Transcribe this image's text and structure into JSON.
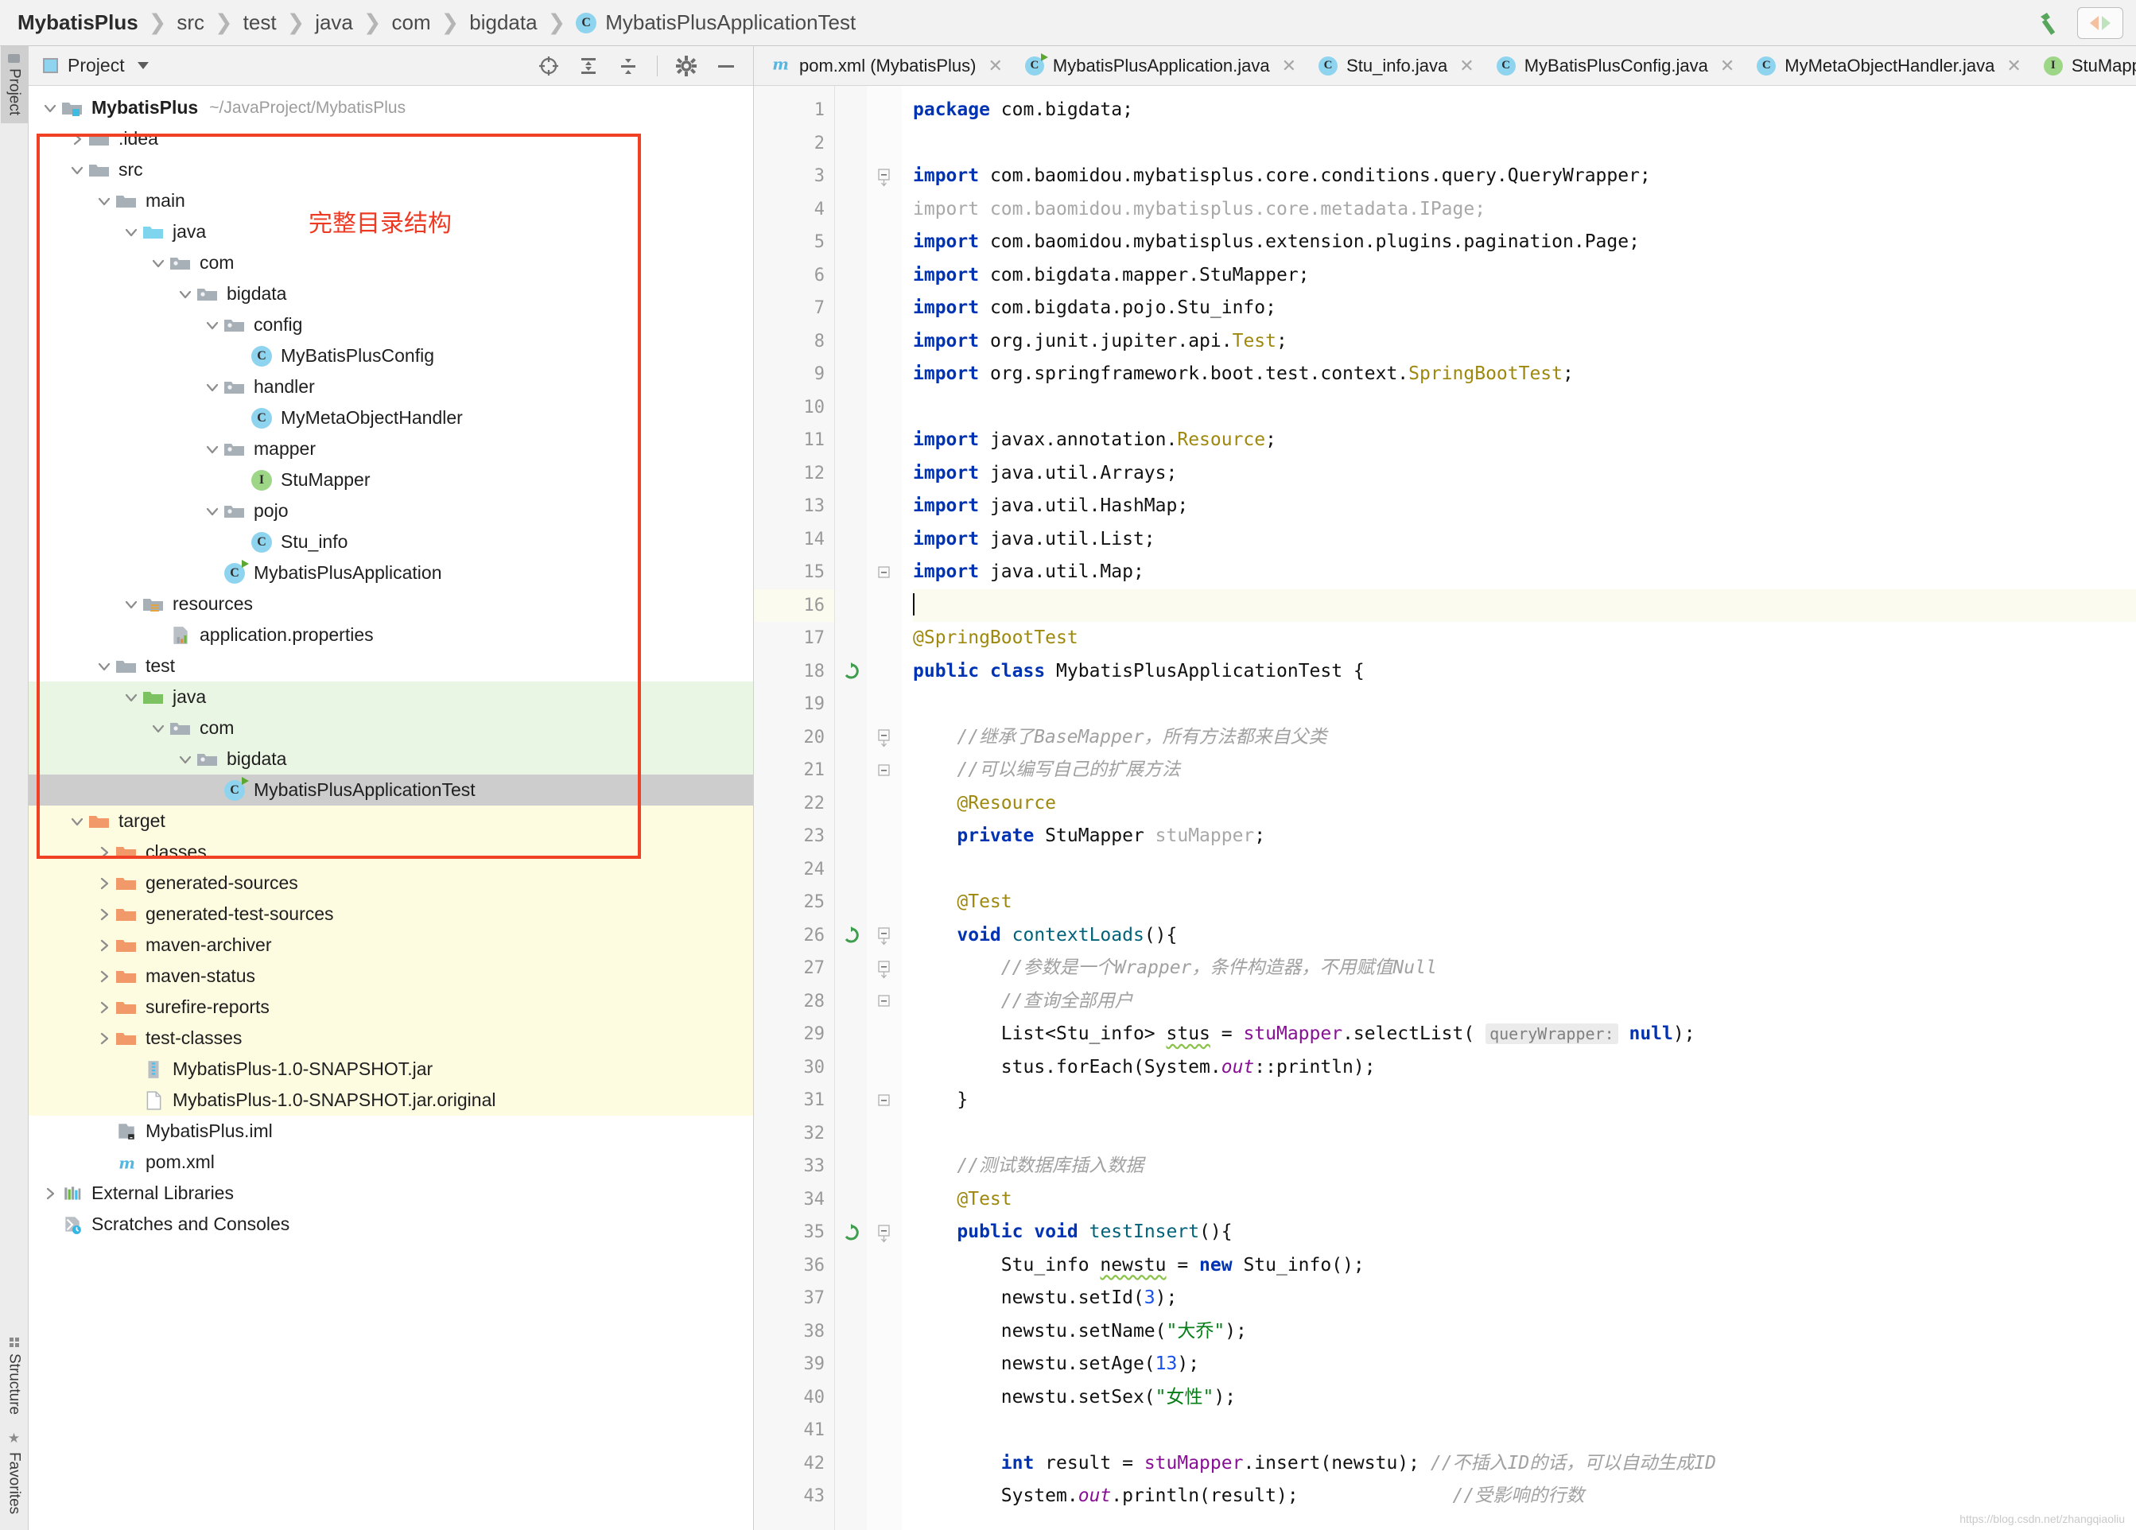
{
  "window": {
    "breadcrumb": [
      {
        "label": "MybatisPlus",
        "type": "root"
      },
      {
        "label": "src",
        "type": "folder"
      },
      {
        "label": "test",
        "type": "folder"
      },
      {
        "label": "java",
        "type": "folder"
      },
      {
        "label": "com",
        "type": "folder"
      },
      {
        "label": "bigdata",
        "type": "folder"
      },
      {
        "label": "MybatisPlusApplicationTest",
        "type": "class"
      }
    ],
    "build_icon": "hammer-icon",
    "layout_toggle_icon": "split-pane-icon"
  },
  "rail": {
    "top": [
      {
        "label": "Project",
        "icon": "project-folder-icon",
        "active": true
      }
    ],
    "bottom": [
      {
        "label": "Structure",
        "icon": "structure-icon",
        "active": false
      },
      {
        "label": "Favorites",
        "icon": "star-icon",
        "active": false
      }
    ]
  },
  "project_panel": {
    "title": "Project",
    "title_icon": "project-view-icon",
    "dropdown_icon": "chevron-down-icon",
    "tools": [
      {
        "name": "locate-in-tree-icon",
        "label": "Select Opened File"
      },
      {
        "name": "expand-all-icon",
        "label": "Expand All"
      },
      {
        "name": "collapse-all-icon",
        "label": "Collapse All"
      },
      {
        "name": "settings-gear-icon",
        "label": "Settings"
      },
      {
        "name": "minimize-icon",
        "label": "Hide"
      }
    ],
    "annotation": {
      "text": "完整目录结构",
      "color": "#ee3a23"
    }
  },
  "tree": [
    {
      "indent": 0,
      "arrow": "down",
      "icon": "module-folder",
      "label": "MybatisPlus",
      "bold": true,
      "path": "~/JavaProject/MybatisPlus",
      "bg": "none"
    },
    {
      "indent": 1,
      "arrow": "right",
      "icon": "folder-gray",
      "label": ".idea",
      "bg": "none"
    },
    {
      "indent": 1,
      "arrow": "down",
      "icon": "folder-gray",
      "label": "src",
      "bg": "none"
    },
    {
      "indent": 2,
      "arrow": "down",
      "icon": "folder-gray",
      "label": "main",
      "bg": "none"
    },
    {
      "indent": 3,
      "arrow": "down",
      "icon": "folder-source-blue",
      "label": "java",
      "bg": "none"
    },
    {
      "indent": 4,
      "arrow": "down",
      "icon": "folder-package",
      "label": "com",
      "bg": "none"
    },
    {
      "indent": 5,
      "arrow": "down",
      "icon": "folder-package",
      "label": "bigdata",
      "bg": "none"
    },
    {
      "indent": 6,
      "arrow": "down",
      "icon": "folder-package",
      "label": "config",
      "bg": "none"
    },
    {
      "indent": 7,
      "arrow": "none",
      "icon": "class-badge",
      "label": "MyBatisPlusConfig",
      "bg": "none"
    },
    {
      "indent": 6,
      "arrow": "down",
      "icon": "folder-package",
      "label": "handler",
      "bg": "none"
    },
    {
      "indent": 7,
      "arrow": "none",
      "icon": "class-badge",
      "label": "MyMetaObjectHandler",
      "bg": "none"
    },
    {
      "indent": 6,
      "arrow": "down",
      "icon": "folder-package",
      "label": "mapper",
      "bg": "none"
    },
    {
      "indent": 7,
      "arrow": "none",
      "icon": "interface-badge",
      "label": "StuMapper",
      "bg": "none"
    },
    {
      "indent": 6,
      "arrow": "down",
      "icon": "folder-package",
      "label": "pojo",
      "bg": "none"
    },
    {
      "indent": 7,
      "arrow": "none",
      "icon": "class-badge",
      "label": "Stu_info",
      "bg": "none"
    },
    {
      "indent": 6,
      "arrow": "none",
      "icon": "class-run-badge",
      "label": "MybatisPlusApplication",
      "bg": "none"
    },
    {
      "indent": 3,
      "arrow": "down",
      "icon": "folder-resources",
      "label": "resources",
      "bg": "none"
    },
    {
      "indent": 4,
      "arrow": "none",
      "icon": "properties-file",
      "label": "application.properties",
      "bg": "none"
    },
    {
      "indent": 2,
      "arrow": "down",
      "icon": "folder-gray",
      "label": "test",
      "bg": "none"
    },
    {
      "indent": 3,
      "arrow": "down",
      "icon": "folder-test-green",
      "label": "java",
      "bg": "testsrc"
    },
    {
      "indent": 4,
      "arrow": "down",
      "icon": "folder-package",
      "label": "com",
      "bg": "testsrc"
    },
    {
      "indent": 5,
      "arrow": "down",
      "icon": "folder-package",
      "label": "bigdata",
      "bg": "testsrc"
    },
    {
      "indent": 6,
      "arrow": "none",
      "icon": "class-run-badge",
      "label": "MybatisPlusApplicationTest",
      "bg": "selected"
    },
    {
      "indent": 1,
      "arrow": "down",
      "icon": "folder-orange",
      "label": "target",
      "bg": "excluded"
    },
    {
      "indent": 2,
      "arrow": "right",
      "icon": "folder-orange",
      "label": "classes",
      "bg": "excluded"
    },
    {
      "indent": 2,
      "arrow": "right",
      "icon": "folder-orange",
      "label": "generated-sources",
      "bg": "excluded"
    },
    {
      "indent": 2,
      "arrow": "right",
      "icon": "folder-orange",
      "label": "generated-test-sources",
      "bg": "excluded"
    },
    {
      "indent": 2,
      "arrow": "right",
      "icon": "folder-orange",
      "label": "maven-archiver",
      "bg": "excluded"
    },
    {
      "indent": 2,
      "arrow": "right",
      "icon": "folder-orange",
      "label": "maven-status",
      "bg": "excluded"
    },
    {
      "indent": 2,
      "arrow": "right",
      "icon": "folder-orange",
      "label": "surefire-reports",
      "bg": "excluded"
    },
    {
      "indent": 2,
      "arrow": "right",
      "icon": "folder-orange",
      "label": "test-classes",
      "bg": "excluded"
    },
    {
      "indent": 3,
      "arrow": "none",
      "icon": "jar-file",
      "label": "MybatisPlus-1.0-SNAPSHOT.jar",
      "bg": "excluded"
    },
    {
      "indent": 3,
      "arrow": "none",
      "icon": "generic-file",
      "label": "MybatisPlus-1.0-SNAPSHOT.jar.original",
      "bg": "excluded"
    },
    {
      "indent": 2,
      "arrow": "none",
      "icon": "iml-file",
      "label": "MybatisPlus.iml",
      "bg": "none"
    },
    {
      "indent": 2,
      "arrow": "none",
      "icon": "maven-file",
      "label": "pom.xml",
      "bg": "none"
    },
    {
      "indent": 0,
      "arrow": "right",
      "icon": "library-icon",
      "label": "External Libraries",
      "bg": "none"
    },
    {
      "indent": 0,
      "arrow": "none",
      "icon": "scratches-icon",
      "label": "Scratches and Consoles",
      "bg": "none"
    }
  ],
  "editor_tabs": [
    {
      "label": "pom.xml (MybatisPlus)",
      "icon": "maven-file",
      "active": false,
      "close_icon": "close-icon"
    },
    {
      "label": "MybatisPlusApplication.java",
      "icon": "class-run-badge",
      "active": false,
      "close_icon": "close-icon"
    },
    {
      "label": "Stu_info.java",
      "icon": "class-badge",
      "active": false,
      "close_icon": "close-icon"
    },
    {
      "label": "MyBatisPlusConfig.java",
      "icon": "class-badge",
      "active": false,
      "close_icon": "close-icon"
    },
    {
      "label": "MyMetaObjectHandler.java",
      "icon": "class-badge",
      "active": false,
      "close_icon": "close-icon"
    },
    {
      "label": "StuMapper.java",
      "icon": "interface-badge",
      "active": false,
      "close_icon": "close-icon"
    }
  ],
  "editor": {
    "caret_line": 16,
    "lines": [
      {
        "n": 1,
        "fold": "none",
        "run": false,
        "html": "<span class=\"kw\">package</span> com.bigdata;"
      },
      {
        "n": 2,
        "fold": "none",
        "run": false,
        "html": ""
      },
      {
        "n": 3,
        "fold": "open",
        "run": false,
        "html": "<span class=\"kw\">import</span> com.baomidou.mybatisplus.core.conditions.query.QueryWrapper;"
      },
      {
        "n": 4,
        "fold": "none",
        "run": false,
        "html": "<span class=\"dim\">import com.baomidou.mybatisplus.core.metadata.IPage;</span>"
      },
      {
        "n": 5,
        "fold": "none",
        "run": false,
        "html": "<span class=\"kw\">import</span> com.baomidou.mybatisplus.extension.plugins.pagination.Page;"
      },
      {
        "n": 6,
        "fold": "none",
        "run": false,
        "html": "<span class=\"kw\">import</span> com.bigdata.mapper.StuMapper;"
      },
      {
        "n": 7,
        "fold": "none",
        "run": false,
        "html": "<span class=\"kw\">import</span> com.bigdata.pojo.Stu_info;"
      },
      {
        "n": 8,
        "fold": "none",
        "run": false,
        "html": "<span class=\"kw\">import</span> org.junit.jupiter.api.<span class=\"ann\">Test</span>;"
      },
      {
        "n": 9,
        "fold": "none",
        "run": false,
        "html": "<span class=\"kw\">import</span> org.springframework.boot.test.context.<span class=\"ann\">SpringBootTest</span>;"
      },
      {
        "n": 10,
        "fold": "none",
        "run": false,
        "html": ""
      },
      {
        "n": 11,
        "fold": "none",
        "run": false,
        "html": "<span class=\"kw\">import</span> javax.annotation.<span class=\"ann\">Resource</span>;"
      },
      {
        "n": 12,
        "fold": "none",
        "run": false,
        "html": "<span class=\"kw\">import</span> java.util.Arrays;"
      },
      {
        "n": 13,
        "fold": "none",
        "run": false,
        "html": "<span class=\"kw\">import</span> java.util.HashMap;"
      },
      {
        "n": 14,
        "fold": "none",
        "run": false,
        "html": "<span class=\"kw\">import</span> java.util.List;"
      },
      {
        "n": 15,
        "fold": "close",
        "run": false,
        "html": "<span class=\"kw\">import</span> java.util.Map;"
      },
      {
        "n": 16,
        "fold": "none",
        "run": false,
        "hl": true,
        "html": "<span class=\"caret\"></span>"
      },
      {
        "n": 17,
        "fold": "none",
        "run": false,
        "html": "<span class=\"ann\">@SpringBootTest</span>"
      },
      {
        "n": 18,
        "fold": "none",
        "run": true,
        "html": "<span class=\"kw\">public</span> <span class=\"kw\">class</span> MybatisPlusApplicationTest {"
      },
      {
        "n": 19,
        "fold": "none",
        "run": false,
        "html": ""
      },
      {
        "n": 20,
        "fold": "open",
        "run": false,
        "html": "    <span class=\"cmt\">//继承了BaseMapper，所有方法都来自父类</span>"
      },
      {
        "n": 21,
        "fold": "close",
        "run": false,
        "html": "    <span class=\"cmt\">//可以编写自己的扩展方法</span>"
      },
      {
        "n": 22,
        "fold": "none",
        "run": false,
        "html": "    <span class=\"ann\">@Resource</span>"
      },
      {
        "n": 23,
        "fold": "none",
        "run": false,
        "html": "    <span class=\"kw\">private</span> StuMapper <span class=\"dim\">stuMapper</span>;"
      },
      {
        "n": 24,
        "fold": "none",
        "run": false,
        "html": ""
      },
      {
        "n": 25,
        "fold": "none",
        "run": false,
        "html": "    <span class=\"ann\">@Test</span>"
      },
      {
        "n": 26,
        "fold": "open",
        "run": true,
        "html": "    <span class=\"kw\">void</span> <span class=\"mth\">contextLoads</span>(){"
      },
      {
        "n": 27,
        "fold": "open",
        "run": false,
        "html": "        <span class=\"cmt\">//参数是一个Wrapper，条件构造器，不用赋值Null</span>"
      },
      {
        "n": 28,
        "fold": "close",
        "run": false,
        "html": "        <span class=\"cmt\">//查询全部用户</span>"
      },
      {
        "n": 29,
        "fold": "none",
        "run": false,
        "html": "        List&lt;Stu_info&gt; <span class=\"wavy\">stus</span> = <span class=\"fld\">stuMapper</span>.selectList( <span class=\"hint\">queryWrapper:</span> <span class=\"kw\">null</span>);"
      },
      {
        "n": 30,
        "fold": "none",
        "run": false,
        "html": "        stus.forEach(System.<span class=\"fldi\">out</span>::println);"
      },
      {
        "n": 31,
        "fold": "close",
        "run": false,
        "html": "    }"
      },
      {
        "n": 32,
        "fold": "none",
        "run": false,
        "html": ""
      },
      {
        "n": 33,
        "fold": "none",
        "run": false,
        "html": "    <span class=\"cmt\">//测试数据库插入数据</span>"
      },
      {
        "n": 34,
        "fold": "none",
        "run": false,
        "html": "    <span class=\"ann\">@Test</span>"
      },
      {
        "n": 35,
        "fold": "open",
        "run": true,
        "html": "    <span class=\"kw\">public</span> <span class=\"kw\">void</span> <span class=\"mth\">testInsert</span>(){"
      },
      {
        "n": 36,
        "fold": "none",
        "run": false,
        "html": "        Stu_info <span class=\"wavy\">newstu</span> = <span class=\"kw\">new</span> Stu_info();"
      },
      {
        "n": 37,
        "fold": "none",
        "run": false,
        "html": "        newstu.setId(<span class=\"num\">3</span>);"
      },
      {
        "n": 38,
        "fold": "none",
        "run": false,
        "html": "        newstu.setName(<span class=\"str\">\"大乔\"</span>);"
      },
      {
        "n": 39,
        "fold": "none",
        "run": false,
        "html": "        newstu.setAge(<span class=\"num\">13</span>);"
      },
      {
        "n": 40,
        "fold": "none",
        "run": false,
        "html": "        newstu.setSex(<span class=\"str\">\"女性\"</span>);"
      },
      {
        "n": 41,
        "fold": "none",
        "run": false,
        "html": ""
      },
      {
        "n": 42,
        "fold": "none",
        "run": false,
        "html": "        <span class=\"kw\">int</span> result = <span class=\"fld\">stuMapper</span>.insert(newstu); <span class=\"cmt\">//不插入ID的话，可以自动生成ID</span>"
      },
      {
        "n": 43,
        "fold": "none",
        "run": false,
        "html": "        System.<span class=\"fldi\">out</span>.println(result);              <span class=\"cmt\">//受影响的行数</span>"
      }
    ]
  },
  "watermark": "https://blog.csdn.net/zhangqiaoliu"
}
